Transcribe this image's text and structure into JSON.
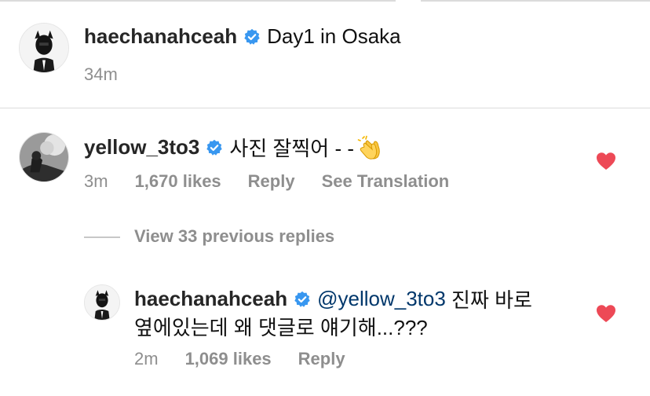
{
  "post": {
    "username": "haechanahceah",
    "caption": "Day1 in Osaka",
    "time": "34m"
  },
  "comment": {
    "username": "yellow_3to3",
    "text": "사진 잘찍어 - -",
    "emoji": "clapping-hands",
    "time": "3m",
    "likes": "1,670 likes",
    "reply_label": "Reply",
    "translation_label": "See Translation"
  },
  "view_replies": "View 33 previous replies",
  "reply": {
    "username": "haechanahceah",
    "mention": "@yellow_3to3",
    "text_line1": " 진짜 바로",
    "text_line2": "옆에있는데 왜 댓글로 얘기해...???",
    "time": "2m",
    "likes": "1,069 likes",
    "reply_label": "Reply"
  },
  "colors": {
    "verified": "#3897f0",
    "heart": "#ed4956",
    "meta": "#8e8e8e",
    "mention": "#00376b"
  }
}
